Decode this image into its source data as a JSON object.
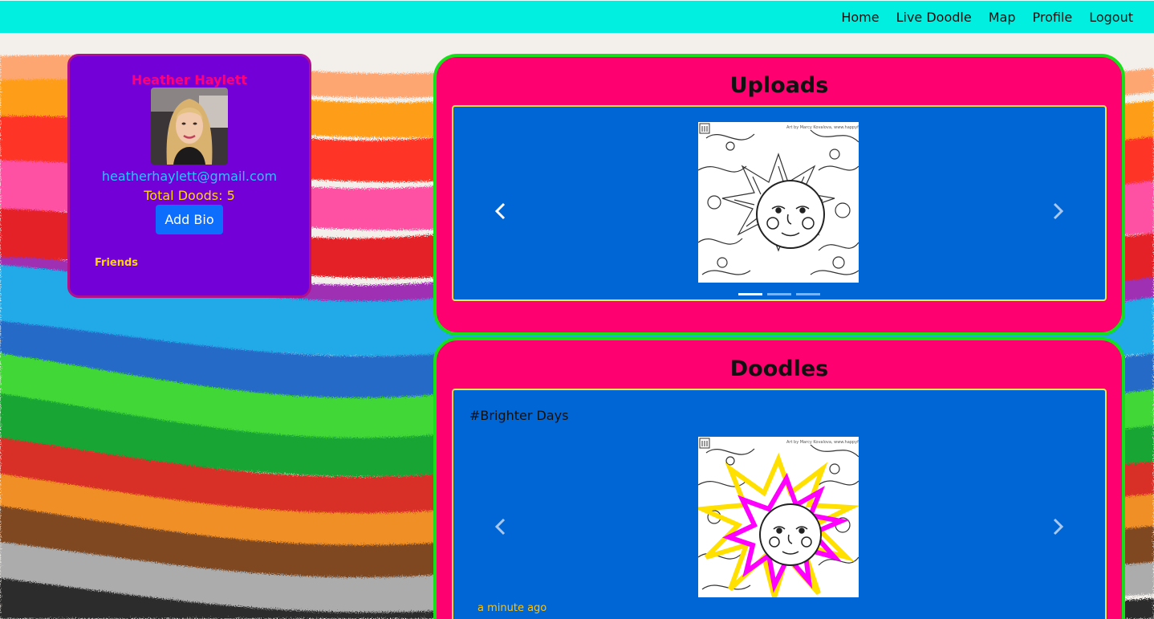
{
  "nav": {
    "links": [
      "Home",
      "Live Doodle",
      "Map",
      "Profile",
      "Logout"
    ]
  },
  "profile": {
    "name": "Heather Haylett",
    "email": "heatherhaylett@gmail.com",
    "total_doods": "Total Doods: 5",
    "add_bio_label": "Add Bio",
    "friends_label": "Friends"
  },
  "uploads": {
    "title": "Uploads",
    "active_slide": 1,
    "slide_count": 3
  },
  "doodles": {
    "title": "Doodles",
    "caption": "#Brighter Days",
    "time": "a minute ago"
  },
  "colors": {
    "navbar": "#00efe0",
    "profile_bg": "#7300d6",
    "panel_bg": "#ff0070",
    "panel_border": "#16e01a",
    "carousel_bg": "#0066d6",
    "carousel_border": "#ffe14a",
    "button": "#0d6efd"
  },
  "icons": {
    "prev": "chevron-left-icon",
    "next": "chevron-right-icon"
  }
}
